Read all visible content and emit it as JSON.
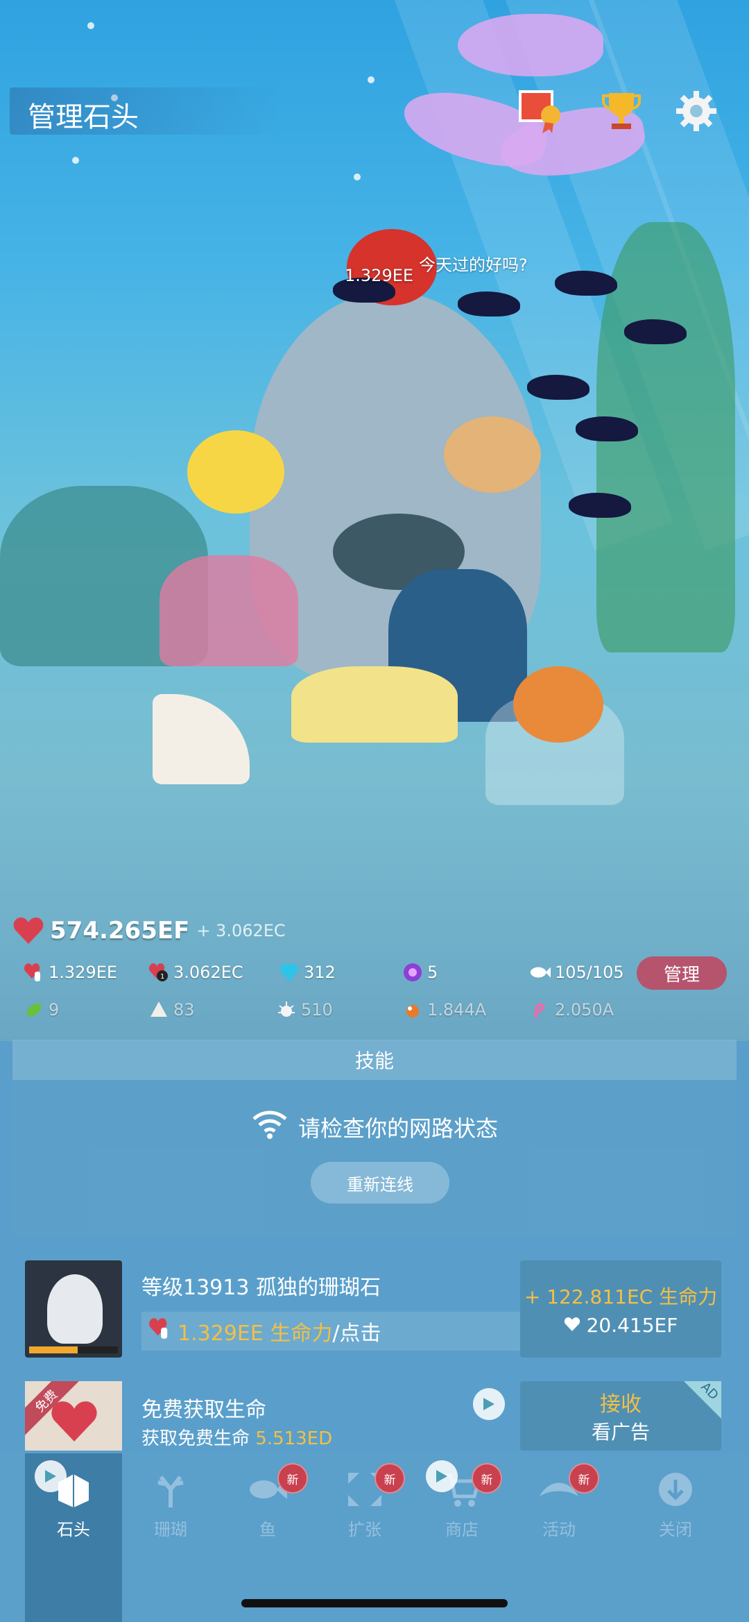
{
  "header": {
    "title": "管理石头"
  },
  "top_icons": [
    "fish-photo-badge-icon",
    "trophy-icon",
    "gear-icon"
  ],
  "scene": {
    "speech_bubble": "今天过的好吗?",
    "floating_value": "1.329EE"
  },
  "vitality": {
    "total": "574.265EF",
    "rate": "+ 3.062EC"
  },
  "stats_row1": {
    "tap": "1.329EE",
    "per_sec": "3.062EC",
    "gems": "312",
    "orbs": "5",
    "fish_count": "105/105",
    "manage_label": "管理"
  },
  "stats_row2": {
    "seaweed": "9",
    "shell": "83",
    "urchin": "510",
    "item4": "1.844A",
    "item5": "2.050A"
  },
  "skill": {
    "tab_label": "技能",
    "network_msg": "请检查你的网路状态",
    "reconnect_label": "重新连线"
  },
  "rock_card": {
    "title": "等级13913 孤独的珊瑚石",
    "sub_value": "1.329EE 生命力",
    "sub_suffix": "/点击",
    "upgrade_gain": "+ 122.811EC 生命力",
    "upgrade_cost": "20.415EF",
    "level_progress": 0.55
  },
  "life_card": {
    "badge": "免费",
    "title": "免费获取生命",
    "sub_prefix": "获取免费生命 ",
    "sub_value": "5.513ED",
    "btn_main": "接收",
    "btn_sub": "看广告",
    "ad_tag": "AD"
  },
  "nav": {
    "items": [
      {
        "label": "石头",
        "icon": "rock-icon"
      },
      {
        "label": "珊瑚",
        "icon": "coral-icon"
      },
      {
        "label": "鱼",
        "icon": "fish-icon"
      },
      {
        "label": "扩张",
        "icon": "expand-icon"
      },
      {
        "label": "商店",
        "icon": "cart-icon"
      },
      {
        "label": "活动",
        "icon": "activity-icon"
      },
      {
        "label": "关闭",
        "icon": "close-down-icon"
      }
    ],
    "new_badge": "新"
  },
  "colors": {
    "accent_gold": "#f4c043",
    "manage_pink": "#b6546e",
    "badge_red": "#c9404e",
    "panel_blue": "#4f8fb4"
  }
}
